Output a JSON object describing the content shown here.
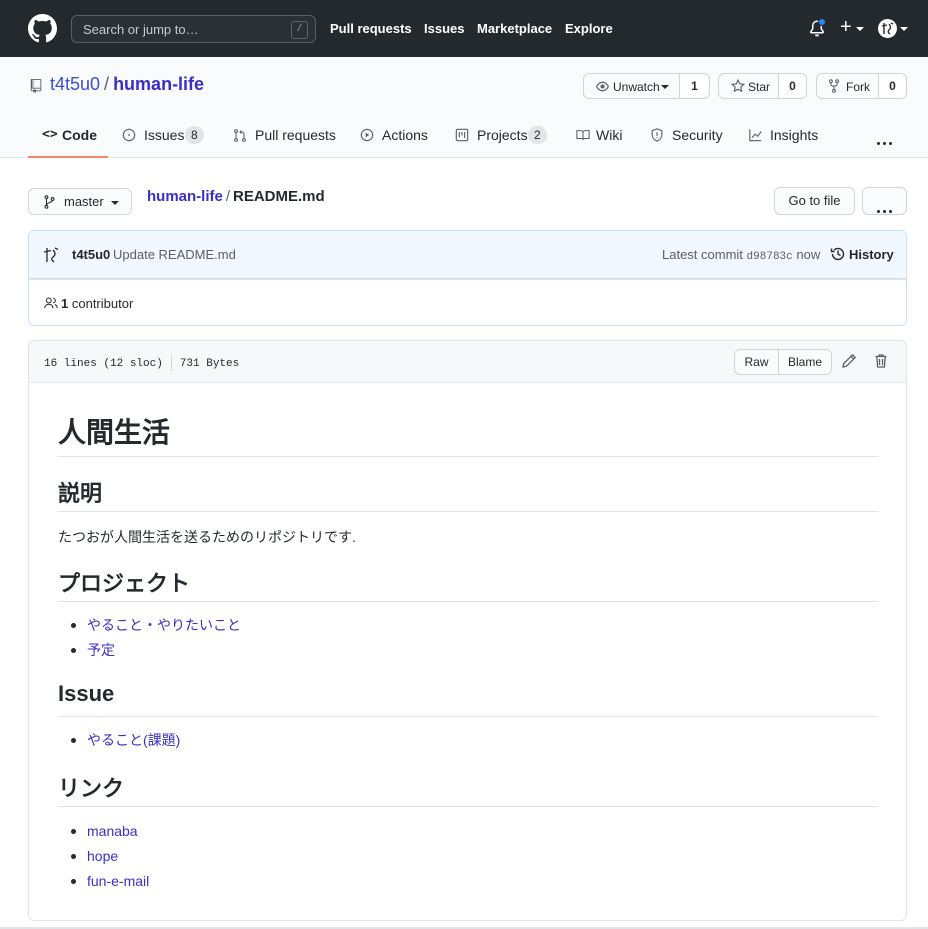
{
  "header": {
    "search_placeholder": "Search or jump to…",
    "search_shortcut": "/",
    "nav": [
      "Pull requests",
      "Issues",
      "Marketplace",
      "Explore"
    ],
    "plus_label": "+"
  },
  "repo": {
    "owner": "t4t5u0",
    "separator": "/",
    "name": "human-life",
    "watch_label": "Unwatch",
    "watch_count": "1",
    "star_label": "Star",
    "star_count": "0",
    "fork_label": "Fork",
    "fork_count": "0"
  },
  "tabs": [
    {
      "label": "Code",
      "icon": "code-icon",
      "active": true
    },
    {
      "label": "Issues",
      "icon": "issue-icon",
      "counter": "8"
    },
    {
      "label": "Pull requests",
      "icon": "pull-request-icon"
    },
    {
      "label": "Actions",
      "icon": "play-icon"
    },
    {
      "label": "Projects",
      "icon": "project-icon",
      "counter": "2"
    },
    {
      "label": "Wiki",
      "icon": "book-icon"
    },
    {
      "label": "Security",
      "icon": "shield-icon"
    },
    {
      "label": "Insights",
      "icon": "graph-icon"
    }
  ],
  "branch": {
    "name": "master",
    "crumb_repo": "human-life",
    "crumb_sep": "/",
    "crumb_file": "README.md",
    "goto_label": "Go to file"
  },
  "commit": {
    "author": "t4t5u0",
    "message": "Update README.md",
    "latest_label": "Latest commit",
    "sha": "d98783c",
    "time": "now",
    "history_label": "History",
    "contributor_count": "1",
    "contributor_label": "contributor"
  },
  "file": {
    "lines": "16 lines (12 sloc)",
    "size": "731 Bytes",
    "raw_label": "Raw",
    "blame_label": "Blame"
  },
  "readme": {
    "title": "人間生活",
    "h_desc": "説明",
    "desc": "たつおが人間生活を送るためのリポジトリです.",
    "h_project": "プロジェクト",
    "project_links": [
      "やること・やりたいこと",
      "予定"
    ],
    "h_issue": "Issue",
    "issue_links": [
      "やること(課題)"
    ],
    "h_links": "リンク",
    "links": [
      "manaba",
      "hope",
      "fun-e-mail"
    ]
  },
  "colors": {
    "header_bg": "#24292e",
    "link": "#3a2fc9",
    "active_tab_underline": "#f9826c",
    "commit_bg": "#f1f8ff",
    "notification_dot": "#2188ff"
  }
}
